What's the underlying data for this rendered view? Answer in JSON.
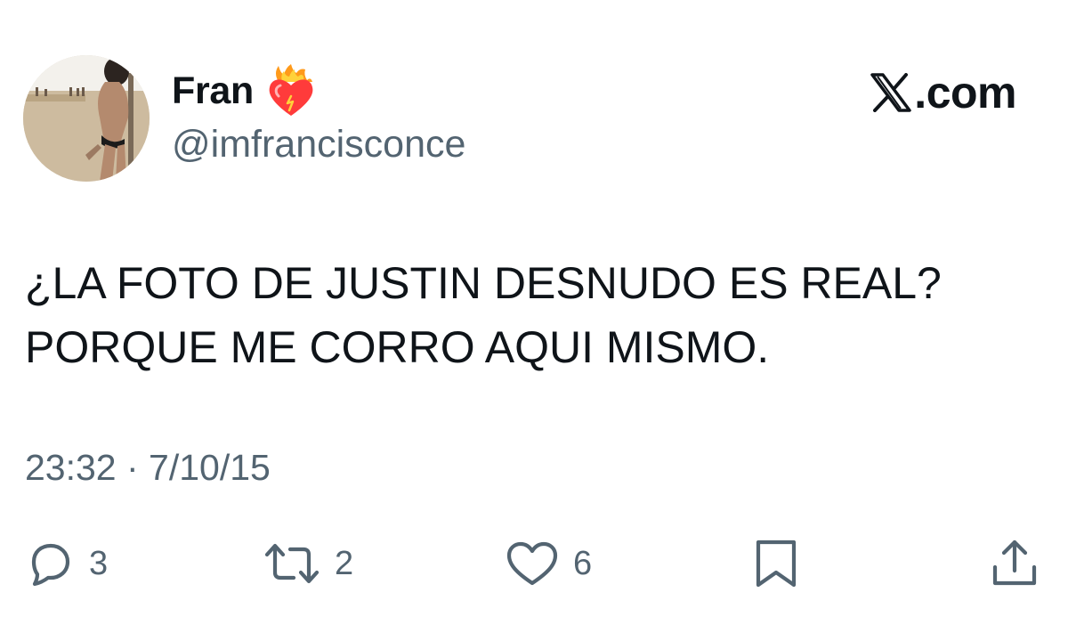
{
  "author": {
    "display_name": "Fran",
    "handle": "@imfrancisconce",
    "badge_icon": "heart-on-fire-icon",
    "avatar_alt": "profile photo"
  },
  "brand": {
    "label": ".com",
    "logo_icon": "x-logo-icon"
  },
  "tweet": {
    "lines": [
      "¿LA FOTO DE JUSTIN DESNUDO ES REAL?",
      "PORQUE ME CORRO AQUI MISMO."
    ],
    "timestamp": "23:32 · 7/10/15"
  },
  "actions": {
    "reply": {
      "icon": "reply-icon",
      "count": "3"
    },
    "retweet": {
      "icon": "retweet-icon",
      "count": "2"
    },
    "like": {
      "icon": "heart-icon",
      "count": "6"
    },
    "bookmark": {
      "icon": "bookmark-icon"
    },
    "share": {
      "icon": "share-icon"
    }
  },
  "colors": {
    "text": "#0f1419",
    "secondary": "#536471",
    "background": "#ffffff"
  }
}
